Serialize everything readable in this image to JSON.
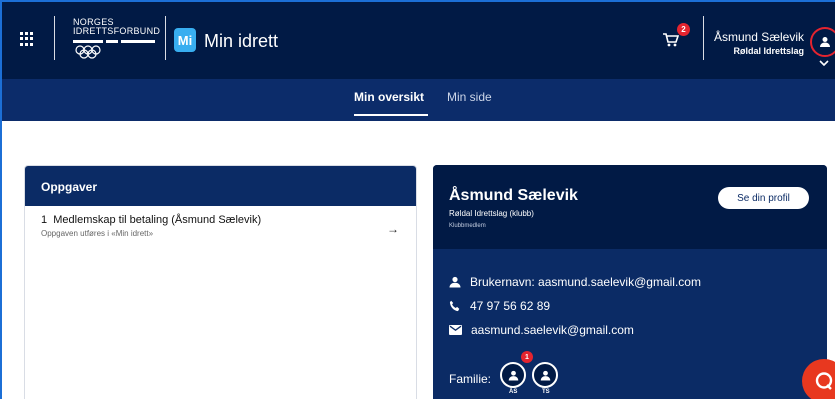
{
  "header": {
    "org_line1": "NORGES",
    "org_line2": "IDRETTSFORBUND",
    "app_badge": "Mi",
    "app_title": "Min idrett",
    "cart_count": "2",
    "user_name": "Åsmund Sælevik",
    "user_club": "Røldal Idrettslag"
  },
  "nav": {
    "tabs": [
      {
        "label": "Min oversikt",
        "active": true
      },
      {
        "label": "Min side",
        "active": false
      }
    ]
  },
  "tasks": {
    "title": "Oppgaver",
    "items": [
      {
        "number": "1",
        "title": "Medlemskap til betaling (Åsmund Sælevik)",
        "subtitle": "Oppgaven utføres i «Min idrett»",
        "arrow": "→"
      }
    ]
  },
  "profile": {
    "name": "Åsmund Sælevik",
    "club": "Røldal Idrettslag (klubb)",
    "role": "Klubbmedlem",
    "button": "Se din profil",
    "username": "Brukernavn: aasmund.saelevik@gmail.com",
    "phone": "47 97 56 62 89",
    "email": "aasmund.saelevik@gmail.com",
    "family_label": "Familie:",
    "family": [
      {
        "initials": "ÅS",
        "badge": "1"
      },
      {
        "initials": "TS",
        "badge": ""
      }
    ]
  },
  "icons": {
    "apps": "grid-icon",
    "cart": "cart-icon",
    "user": "user-icon",
    "phone": "phone-icon",
    "mail": "mail-icon",
    "chat": "chat-icon",
    "chevron": "chevron-down-icon"
  },
  "colors": {
    "header_bg": "#011a45",
    "nav_bg": "#0c2c6a",
    "card_bg": "#0b2b65",
    "accent_blue": "#38aef0",
    "badge_red": "#e4242f",
    "chat_red": "#e8381f"
  }
}
